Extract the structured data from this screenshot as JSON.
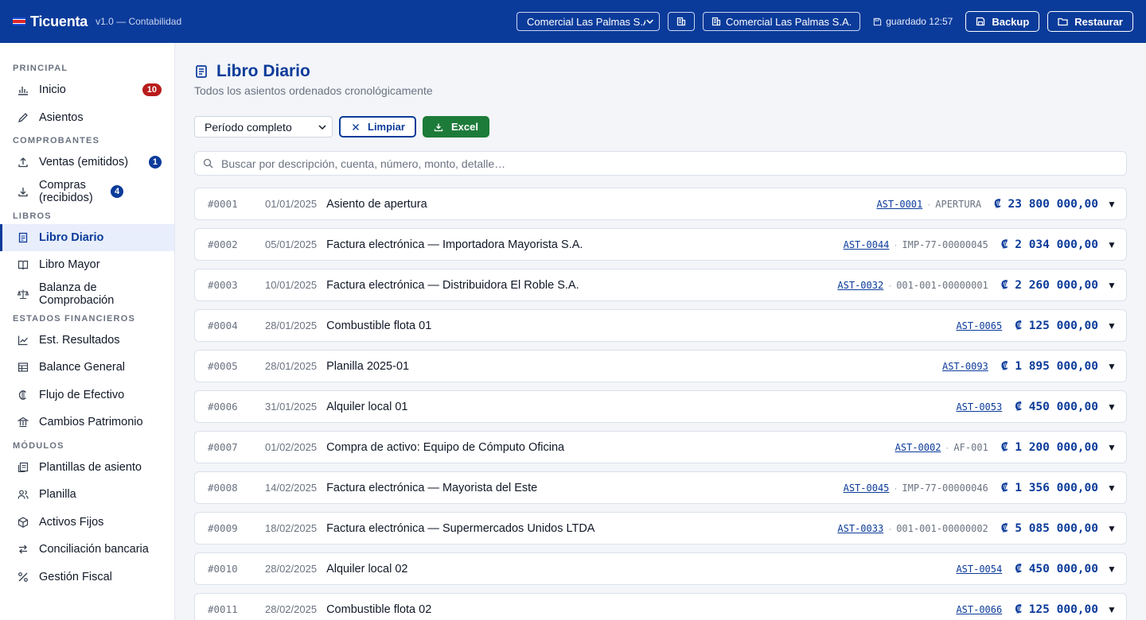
{
  "topbar": {
    "brand": "Ticuenta",
    "version": "v1.0 — Contabilidad",
    "company_selected": "Comercial Las Palmas S.A.",
    "company_label": "Comercial Las Palmas S.A.",
    "saved": "guardado 12:57",
    "backup_label": "Backup",
    "restore_label": "Restaurar"
  },
  "sidebar": {
    "sections": [
      {
        "title": "PRINCIPAL",
        "items": [
          {
            "label": "Inicio",
            "icon": "chart-bar-icon",
            "badge": "10",
            "badge_color": "red"
          },
          {
            "label": "Asientos",
            "icon": "pencil-icon"
          }
        ]
      },
      {
        "title": "COMPROBANTES",
        "items": [
          {
            "label": "Ventas (emitidos)",
            "icon": "upload-icon",
            "badge": "1",
            "badge_color": "blue"
          },
          {
            "label": "Compras (recibidos)",
            "icon": "download-icon",
            "badge": "4",
            "badge_color": "blue"
          }
        ]
      },
      {
        "title": "LIBROS",
        "items": [
          {
            "label": "Libro Diario",
            "icon": "document-icon",
            "active": true
          },
          {
            "label": "Libro Mayor",
            "icon": "book-icon"
          },
          {
            "label": "Balanza de Comprobación",
            "icon": "scale-icon"
          }
        ]
      },
      {
        "title": "ESTADOS FINANCIEROS",
        "items": [
          {
            "label": "Est. Resultados",
            "icon": "line-chart-icon"
          },
          {
            "label": "Balance General",
            "icon": "table-icon"
          },
          {
            "label": "Flujo de Efectivo",
            "icon": "currency-icon"
          },
          {
            "label": "Cambios Patrimonio",
            "icon": "bank-icon"
          }
        ]
      },
      {
        "title": "MÓDULOS",
        "items": [
          {
            "label": "Plantillas de asiento",
            "icon": "template-icon"
          },
          {
            "label": "Planilla",
            "icon": "users-icon"
          },
          {
            "label": "Activos Fijos",
            "icon": "box-icon"
          },
          {
            "label": "Conciliación bancaria",
            "icon": "swap-icon"
          },
          {
            "label": "Gestión Fiscal",
            "icon": "percent-icon"
          }
        ]
      }
    ]
  },
  "main": {
    "title": "Libro Diario",
    "subtitle": "Todos los asientos ordenados cronológicamente",
    "period_selected": "Período completo",
    "clear_label": "Limpiar",
    "excel_label": "Excel",
    "search_placeholder": "Buscar por descripción, cuenta, número, monto, detalle…"
  },
  "entries": [
    {
      "num": "#0001",
      "date": "01/01/2025",
      "desc": "Asiento de apertura",
      "ref": "AST-0001",
      "doc": "APERTURA",
      "amount": "₡ 23 800 000,00"
    },
    {
      "num": "#0002",
      "date": "05/01/2025",
      "desc": "Factura electrónica — Importadora Mayorista S.A.",
      "ref": "AST-0044",
      "doc": "IMP-77-00000045",
      "amount": "₡ 2 034 000,00"
    },
    {
      "num": "#0003",
      "date": "10/01/2025",
      "desc": "Factura electrónica — Distribuidora El Roble S.A.",
      "ref": "AST-0032",
      "doc": "001-001-00000001",
      "amount": "₡ 2 260 000,00"
    },
    {
      "num": "#0004",
      "date": "28/01/2025",
      "desc": "Combustible flota 01",
      "ref": "AST-0065",
      "doc": "",
      "amount": "₡ 125 000,00"
    },
    {
      "num": "#0005",
      "date": "28/01/2025",
      "desc": "Planilla 2025-01",
      "ref": "AST-0093",
      "doc": "",
      "amount": "₡ 1 895 000,00"
    },
    {
      "num": "#0006",
      "date": "31/01/2025",
      "desc": "Alquiler local 01",
      "ref": "AST-0053",
      "doc": "",
      "amount": "₡ 450 000,00"
    },
    {
      "num": "#0007",
      "date": "01/02/2025",
      "desc": "Compra de activo: Equipo de Cómputo Oficina",
      "ref": "AST-0002",
      "doc": "AF-001",
      "amount": "₡ 1 200 000,00"
    },
    {
      "num": "#0008",
      "date": "14/02/2025",
      "desc": "Factura electrónica — Mayorista del Este",
      "ref": "AST-0045",
      "doc": "IMP-77-00000046",
      "amount": "₡ 1 356 000,00"
    },
    {
      "num": "#0009",
      "date": "18/02/2025",
      "desc": "Factura electrónica — Supermercados Unidos LTDA",
      "ref": "AST-0033",
      "doc": "001-001-00000002",
      "amount": "₡ 5 085 000,00"
    },
    {
      "num": "#0010",
      "date": "28/02/2025",
      "desc": "Alquiler local 02",
      "ref": "AST-0054",
      "doc": "",
      "amount": "₡ 450 000,00"
    },
    {
      "num": "#0011",
      "date": "28/02/2025",
      "desc": "Combustible flota 02",
      "ref": "AST-0066",
      "doc": "",
      "amount": "₡ 125 000,00"
    }
  ],
  "colors": {
    "brand": "#0b3b9a",
    "excel": "#1d7b3a",
    "badge_red": "#b91c1c"
  }
}
